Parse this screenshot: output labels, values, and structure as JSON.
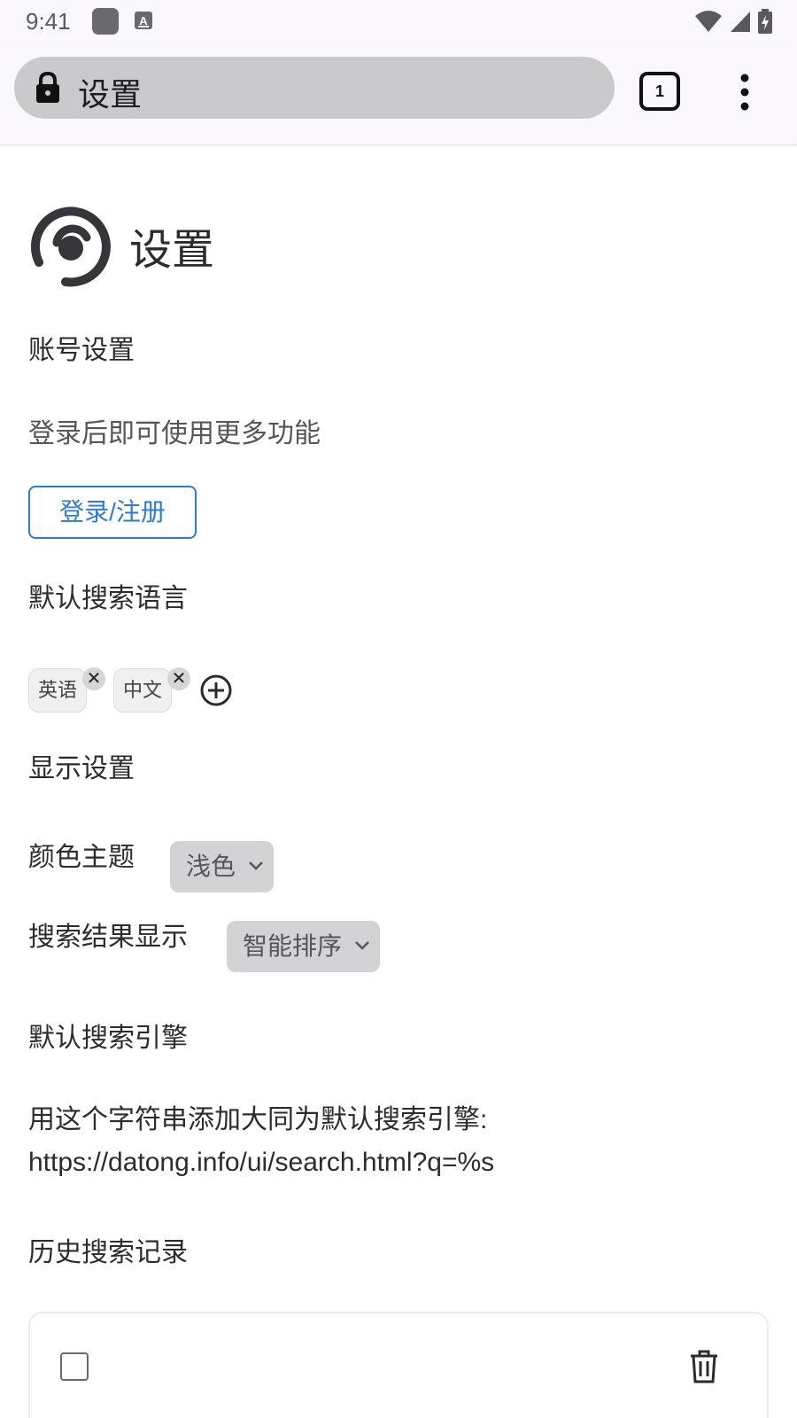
{
  "status_bar": {
    "time": "9:41",
    "icons": [
      "app-icon",
      "a-icon",
      "wifi-icon",
      "signal-icon",
      "battery-icon"
    ]
  },
  "browser": {
    "url_text": "设置",
    "tab_count": "1",
    "icons": [
      "lock-icon",
      "tab-counter",
      "more-menu-icon"
    ]
  },
  "page": {
    "title": "设置",
    "account": {
      "heading": "账号设置",
      "hint": "登录后即可使用更多功能",
      "login_button": "登录/注册"
    },
    "language": {
      "heading": "默认搜索语言",
      "chips": [
        "英语",
        "中文"
      ],
      "remove_symbol": "✕"
    },
    "display": {
      "heading": "显示设置",
      "theme_label": "颜色主题",
      "theme_value": "浅色",
      "results_label": "搜索结果显示",
      "results_value": "智能排序"
    },
    "engine": {
      "heading": "默认搜索引擎",
      "text_line1": "用这个字符串添加大同为默认搜索引擎:",
      "text_line2": "https://datong.info/ui/search.html?q=%s"
    },
    "history": {
      "heading": "历史搜索记录"
    }
  },
  "colors": {
    "accent": "#2d7ad8",
    "url_pill": "#cacacc",
    "toolbar_bg": "#fbf8fd"
  }
}
